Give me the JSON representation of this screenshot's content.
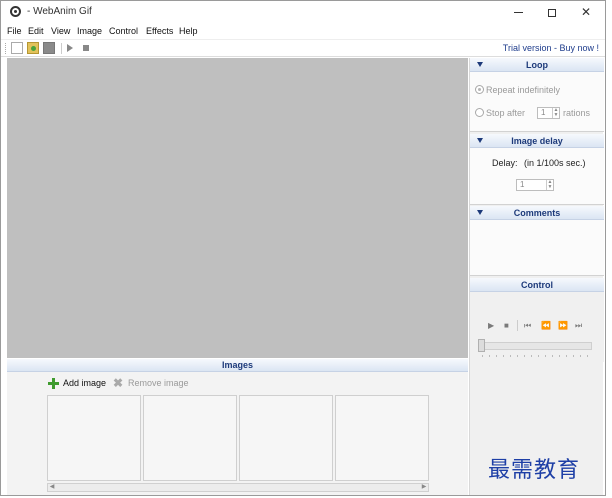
{
  "window": {
    "title": "- WebAnim Gif",
    "minimize": "minimize",
    "maximize": "maximize",
    "close_label": "✕"
  },
  "menu": {
    "items": [
      "File",
      "Edit",
      "View",
      "Image",
      "Control",
      "Effects",
      "Help"
    ]
  },
  "toolbar": {
    "buttons": [
      "new-file-icon",
      "open-file-icon",
      "save-file-icon",
      "play-icon",
      "stop-icon"
    ],
    "trial_link": "Trial version - Buy now !"
  },
  "loop": {
    "title": "Loop",
    "repeat_label": "Repeat indefinitely",
    "stop_after_label": "Stop after",
    "stop_after_value": "1",
    "iterations_label": "rations",
    "repeat_selected": true
  },
  "image_delay": {
    "title": "Image delay",
    "delay_label": "Delay:",
    "unit_label": "(in 1/100s sec.)",
    "delay_value": "1"
  },
  "comments": {
    "title": "Comments"
  },
  "control": {
    "title": "Control",
    "buttons": [
      "play-icon",
      "stop-icon",
      "first-frame-icon",
      "previous-frame-icon",
      "next-frame-icon",
      "last-frame-icon"
    ],
    "slider_position": 0
  },
  "images": {
    "title": "Images",
    "add_label": "Add image",
    "remove_label": "Remove image",
    "thumbnail_count": 4
  },
  "watermark": "最需教育",
  "colors": {
    "canvas": "#bfbfbf",
    "header_text": "#1d3a7a",
    "trial_link": "#1f3d8c",
    "add_icon": "#3f9b2f",
    "watermark": "#1e3fa6"
  }
}
